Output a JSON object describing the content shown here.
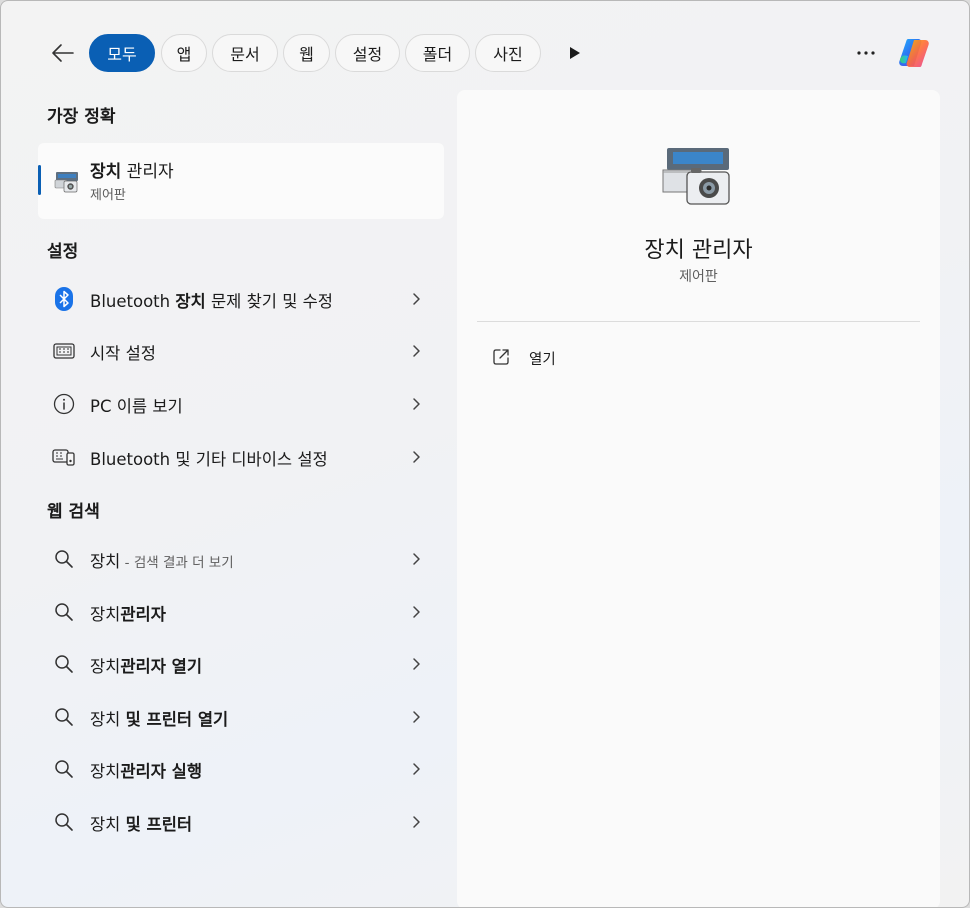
{
  "tabs": [
    {
      "label": "모두",
      "active": true
    },
    {
      "label": "앱"
    },
    {
      "label": "문서"
    },
    {
      "label": "웹"
    },
    {
      "label": "설정"
    },
    {
      "label": "폴더"
    },
    {
      "label": "사진"
    }
  ],
  "sections": {
    "best": "가장 정확",
    "settings": "설정",
    "web": "웹 검색"
  },
  "best_match": {
    "title_bold": "장치",
    "title_rest": " 관리자",
    "subtitle": "제어판"
  },
  "settings_items": [
    {
      "pre": "Bluetooth ",
      "bold": "장치",
      "post": " 문제 찾기 및 수정",
      "icon": "bluetooth-icon"
    },
    {
      "pre": "시작 설정",
      "bold": "",
      "post": "",
      "icon": "keyboard-icon"
    },
    {
      "pre": "PC 이름 보기",
      "bold": "",
      "post": "",
      "icon": "info-icon"
    },
    {
      "pre": "Bluetooth 및 기타 디바이스 설정",
      "bold": "",
      "post": "",
      "icon": "devices-icon"
    }
  ],
  "web_items": [
    {
      "pre": "장치",
      "bold": "",
      "dim": " - 검색 결과 더 보기"
    },
    {
      "pre": "장치",
      "bold": "관리자",
      "dim": ""
    },
    {
      "pre": "장치",
      "bold": "관리자 열기",
      "dim": ""
    },
    {
      "pre": "장치 ",
      "bold": "및 프린터 열기",
      "dim": ""
    },
    {
      "pre": "장치",
      "bold": "관리자 실행",
      "dim": ""
    },
    {
      "pre": "장치 ",
      "bold": "및 프린터",
      "dim": ""
    }
  ],
  "preview": {
    "title": "장치 관리자",
    "subtitle": "제어판",
    "action_label": "열기"
  },
  "colors": {
    "accent": "#0a5fb4",
    "bluetooth": "#1a73e8"
  }
}
